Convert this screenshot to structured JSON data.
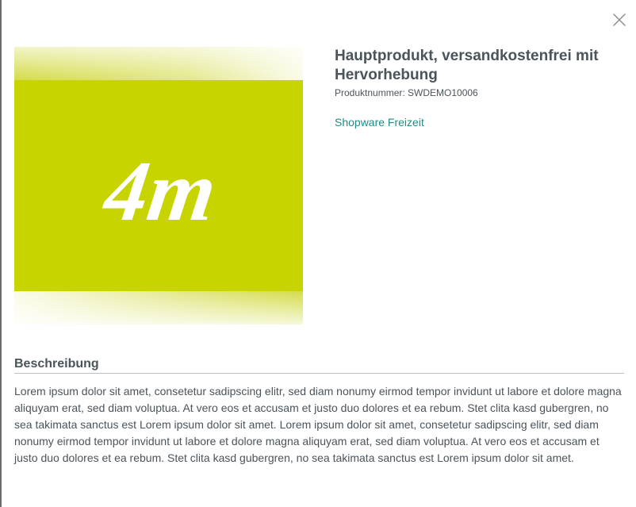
{
  "modal": {
    "close_icon": "close-icon"
  },
  "image": {
    "logo_text": "4m",
    "background_color": "#c8d400",
    "logo_color": "#ffffff"
  },
  "product": {
    "title": "Hauptprodukt, versandkostenfrei mit Hervorhebung",
    "number_label": "Produktnummer: SWDEMO10006",
    "manufacturer": "Shopware Freizeit"
  },
  "description": {
    "heading": "Beschreibung",
    "text": "Lorem ipsum dolor sit amet, consetetur sadipscing elitr, sed diam nonumy eirmod tempor invidunt ut labore et dolore magna aliquyam erat, sed diam voluptua. At vero eos et accusam et justo duo dolores et ea rebum. Stet clita kasd gubergren, no sea takimata sanctus est Lorem ipsum dolor sit amet. Lorem ipsum dolor sit amet, consetetur sadipscing elitr, sed diam nonumy eirmod tempor invidunt ut labore et dolore magna aliquyam erat, sed diam voluptua. At vero eos et accusam et justo duo dolores et ea rebum. Stet clita kasd gubergren, no sea takimata sanctus est Lorem ipsum dolor sit amet."
  },
  "colors": {
    "accent": "#1f8c86",
    "text": "#4a545b",
    "divider": "#bcc1c7"
  }
}
